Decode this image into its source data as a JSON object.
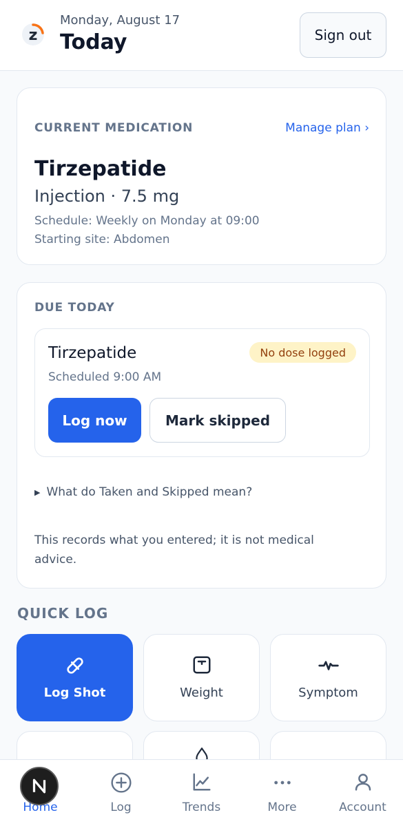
{
  "header": {
    "date": "Monday, August 17",
    "title": "Today",
    "sign_out_label": "Sign out"
  },
  "current_medication": {
    "section_label": "CURRENT MEDICATION",
    "manage_link": "Manage plan ›",
    "name": "Tirzepatide",
    "dose": "Injection · 7.5 mg",
    "schedule": "Schedule: Weekly on Monday at 09:00",
    "site": "Starting site: Abdomen"
  },
  "due_today": {
    "section_label": "DUE TODAY",
    "dose": {
      "name": "Tirzepatide",
      "status_badge": "No dose logged",
      "scheduled": "Scheduled 9:00 AM",
      "log_now_label": "Log now",
      "mark_skipped_label": "Mark skipped"
    },
    "disclosure": "What do Taken and Skipped mean?",
    "note": "This records what you entered; it is not medical advice."
  },
  "quick_log": {
    "section_label": "QUICK LOG",
    "tiles": [
      {
        "label": "Log Shot",
        "icon": "pill-icon"
      },
      {
        "label": "Weight",
        "icon": "scale-icon"
      },
      {
        "label": "Symptom",
        "icon": "pulse-icon"
      }
    ]
  },
  "bottom_nav": {
    "items": [
      {
        "label": "Home",
        "icon": "home-icon"
      },
      {
        "label": "Log",
        "icon": "plus-circle-icon"
      },
      {
        "label": "Trends",
        "icon": "chart-icon"
      },
      {
        "label": "More",
        "icon": "more-icon"
      },
      {
        "label": "Account",
        "icon": "user-icon"
      }
    ]
  },
  "colors": {
    "accent": "#2563eb",
    "badge_bg": "#fef3c7",
    "badge_text": "#92400e",
    "logo_orange": "#f97316"
  }
}
